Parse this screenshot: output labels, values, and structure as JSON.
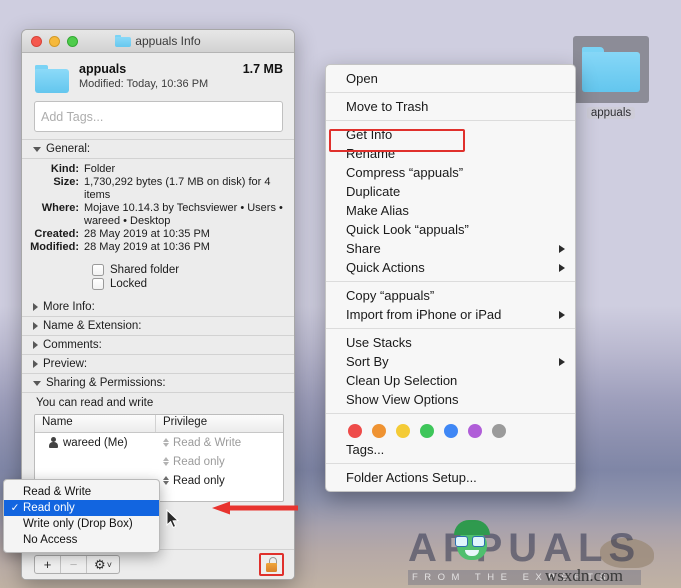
{
  "desktop": {
    "icon": {
      "label": "appuals",
      "icon": "folder-icon"
    }
  },
  "info_window": {
    "title": "appuals Info",
    "title_icon": "folder-icon",
    "traffic_lights": [
      "close-button",
      "minimize-button",
      "zoom-button"
    ],
    "header": {
      "name": "appuals",
      "modified": "Modified: Today, 10:36 PM",
      "size": "1.7 MB",
      "icon": "folder-icon"
    },
    "tags_placeholder": "Add Tags...",
    "sections": {
      "general": {
        "label": "General:",
        "expanded": true,
        "rows": [
          {
            "key": "Kind:",
            "value": "Folder"
          },
          {
            "key": "Size:",
            "value": "1,730,292 bytes (1.7 MB on disk) for 4 items"
          },
          {
            "key": "Where:",
            "value": "Mojave 10.14.3 by Techsviewer • Users • wareed • Desktop"
          },
          {
            "key": "Created:",
            "value": "28 May 2019 at 10:35 PM"
          },
          {
            "key": "Modified:",
            "value": "28 May 2019 at 10:36 PM"
          }
        ],
        "checkboxes": [
          {
            "label": "Shared folder",
            "checked": false
          },
          {
            "label": "Locked",
            "checked": false
          }
        ]
      },
      "collapsed": [
        {
          "label": "More Info:"
        },
        {
          "label": "Name & Extension:"
        },
        {
          "label": "Comments:"
        },
        {
          "label": "Preview:"
        }
      ],
      "sharing": {
        "label": "Sharing & Permissions:",
        "expanded": true,
        "note": "You can read and write",
        "columns": [
          "Name",
          "Privilege"
        ],
        "rows": [
          {
            "name": "wareed (Me)",
            "privilege": "Read & Write",
            "active": false
          },
          {
            "name": "",
            "privilege": "Read only",
            "active": false
          },
          {
            "name": "",
            "privilege": "Read only",
            "active": true
          },
          {
            "name": "",
            "privilege": "",
            "active": false
          }
        ]
      }
    },
    "footer": {
      "add_label": "+",
      "remove_label": "−",
      "action_label": "⚙",
      "action_chevron": "˅",
      "lock_icon": "unlocked-padlock-icon"
    }
  },
  "privilege_menu": {
    "items": [
      {
        "label": "Read & Write",
        "selected": false
      },
      {
        "label": "Read only",
        "selected": true
      },
      {
        "label": "Write only (Drop Box)",
        "selected": false
      },
      {
        "label": "No Access",
        "selected": false
      }
    ],
    "check_glyph": "✓"
  },
  "context_menu": {
    "groups": [
      [
        {
          "label": "Open",
          "submenu": false
        }
      ],
      [
        {
          "label": "Move to Trash",
          "submenu": false
        }
      ],
      [
        {
          "label": "Get Info",
          "submenu": false,
          "highlighted": true
        },
        {
          "label": "Rename",
          "submenu": false
        },
        {
          "label": "Compress “appuals”",
          "submenu": false
        },
        {
          "label": "Duplicate",
          "submenu": false
        },
        {
          "label": "Make Alias",
          "submenu": false
        },
        {
          "label": "Quick Look “appuals”",
          "submenu": false
        },
        {
          "label": "Share",
          "submenu": true
        },
        {
          "label": "Quick Actions",
          "submenu": true
        }
      ],
      [
        {
          "label": "Copy “appuals”",
          "submenu": false
        },
        {
          "label": "Import from iPhone or iPad",
          "submenu": true
        }
      ],
      [
        {
          "label": "Use Stacks",
          "submenu": false
        },
        {
          "label": "Sort By",
          "submenu": true
        },
        {
          "label": "Clean Up Selection",
          "submenu": false
        },
        {
          "label": "Show View Options",
          "submenu": false
        }
      ]
    ],
    "tag_colors": [
      "#ee4b49",
      "#ef9332",
      "#f4cb36",
      "#3ec65a",
      "#3f87f5",
      "#b05ed8",
      "#9b9b9b"
    ],
    "tags_label": "Tags...",
    "folder_actions_label": "Folder Actions Setup..."
  },
  "annotations": {
    "highlight_color": "#e0302c",
    "arrow_color": "#e8332e"
  },
  "watermark": {
    "brand": "APPUALS",
    "tagline": "FROM THE EXPERTS",
    "site": "wsxdn.com"
  }
}
